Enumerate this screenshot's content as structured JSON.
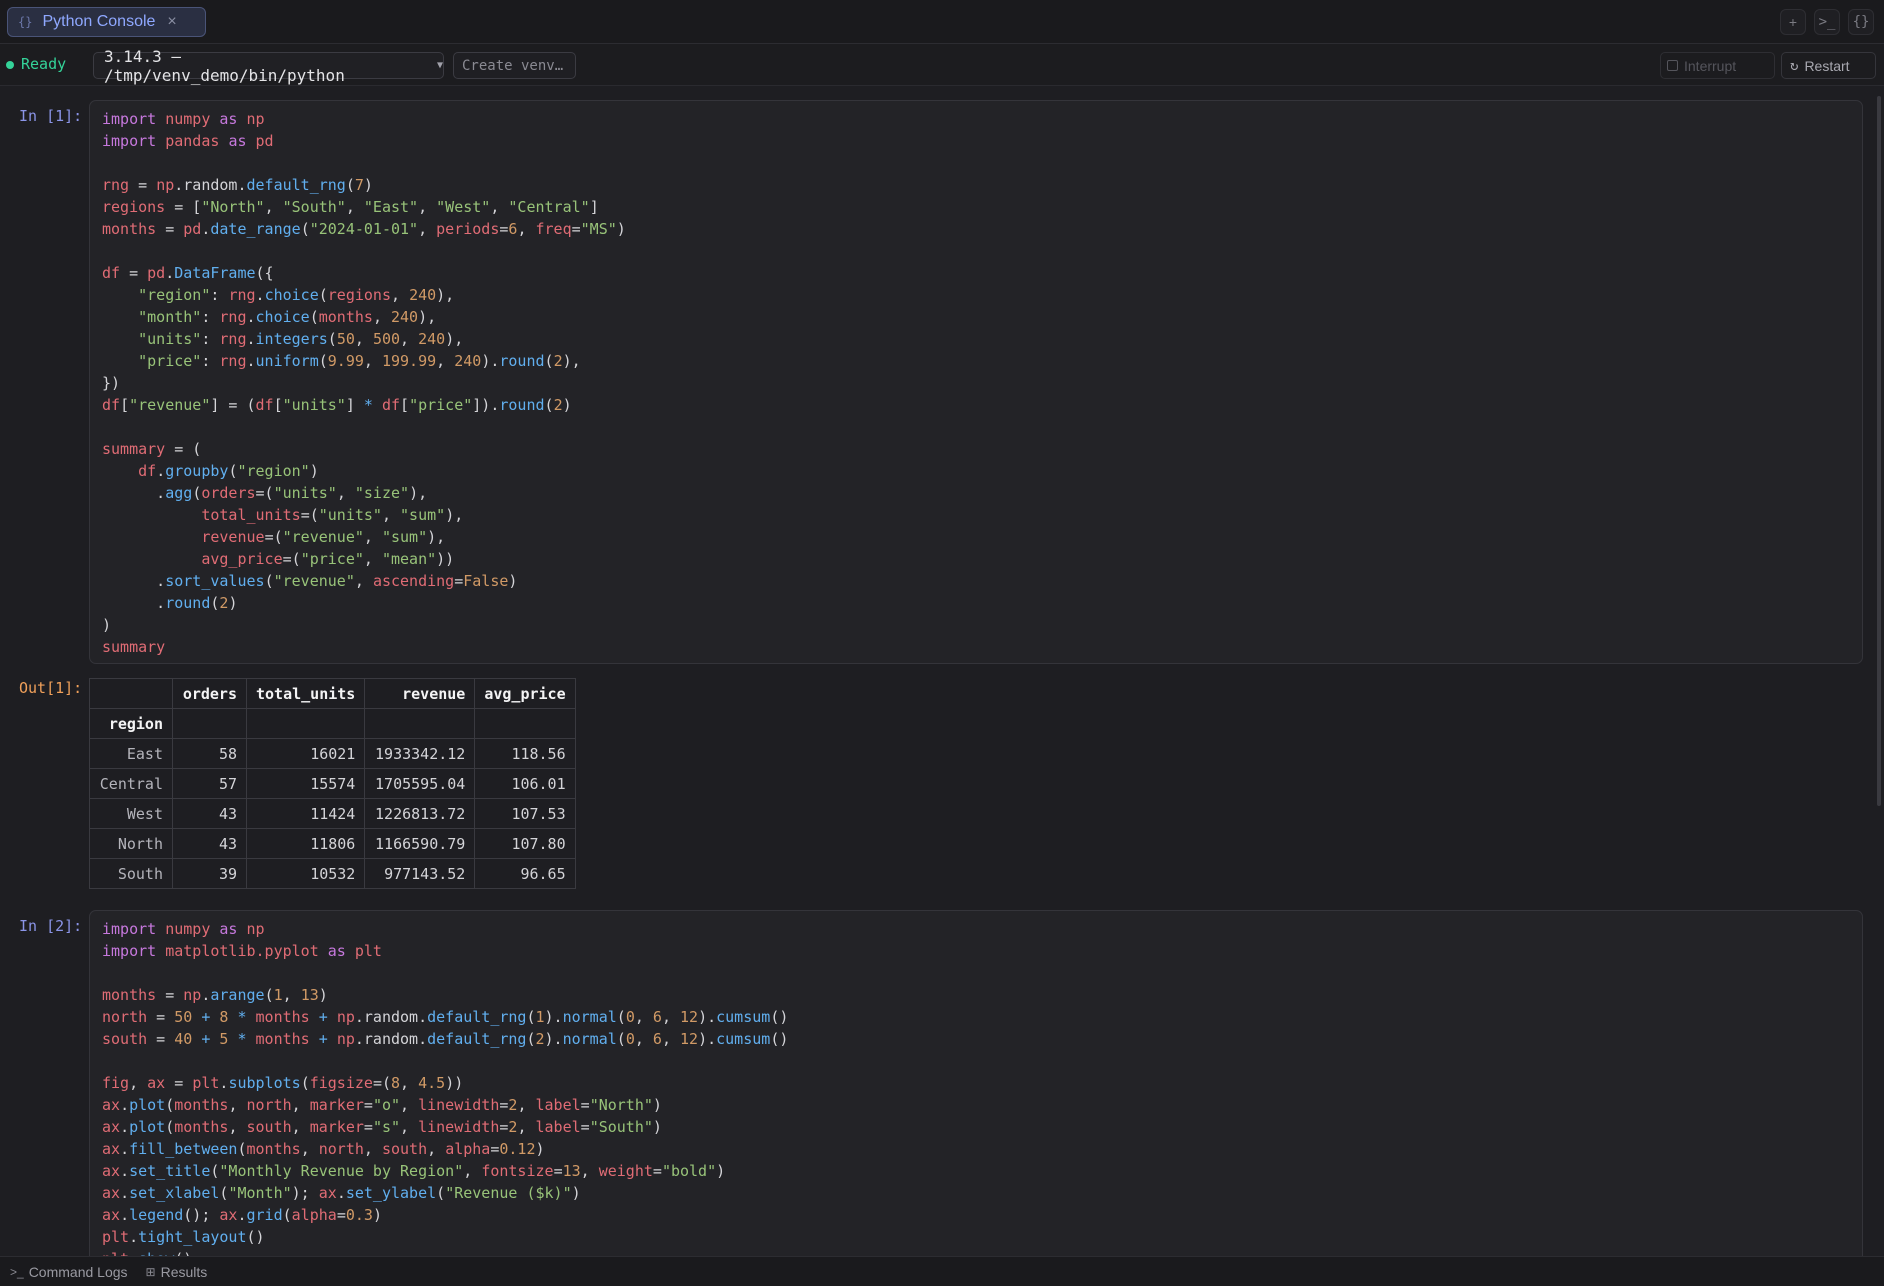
{
  "tab": {
    "title": "Python Console",
    "icon": "braces-icon"
  },
  "toolbar_icons": [
    "plus-icon",
    "terminal-icon",
    "braces-icon"
  ],
  "status": {
    "text": "Ready",
    "color": "#34d399"
  },
  "interpreter": {
    "label": "3.14.3 — /tmp/venv_demo/bin/python"
  },
  "create_venv": {
    "label": "Create venv…"
  },
  "interrupt": {
    "label": "Interrupt"
  },
  "restart": {
    "label": "Restart"
  },
  "cells": [
    {
      "prompt": "In [1]:"
    },
    {
      "prompt": "In [2]:"
    }
  ],
  "output1": {
    "prompt": "Out[1]:",
    "columns": [
      "orders",
      "total_units",
      "revenue",
      "avg_price"
    ],
    "index_name": "region",
    "rows": [
      {
        "region": "East",
        "orders": "58",
        "total_units": "16021",
        "revenue": "1933342.12",
        "avg_price": "118.56"
      },
      {
        "region": "Central",
        "orders": "57",
        "total_units": "15574",
        "revenue": "1705595.04",
        "avg_price": "106.01"
      },
      {
        "region": "West",
        "orders": "43",
        "total_units": "11424",
        "revenue": "1226813.72",
        "avg_price": "107.53"
      },
      {
        "region": "North",
        "orders": "43",
        "total_units": "11806",
        "revenue": "1166590.79",
        "avg_price": "107.80"
      },
      {
        "region": "South",
        "orders": "39",
        "total_units": "10532",
        "revenue": "977143.52",
        "avg_price": "96.65"
      }
    ]
  },
  "footer": {
    "command_logs": "Command Logs",
    "results": "Results"
  }
}
